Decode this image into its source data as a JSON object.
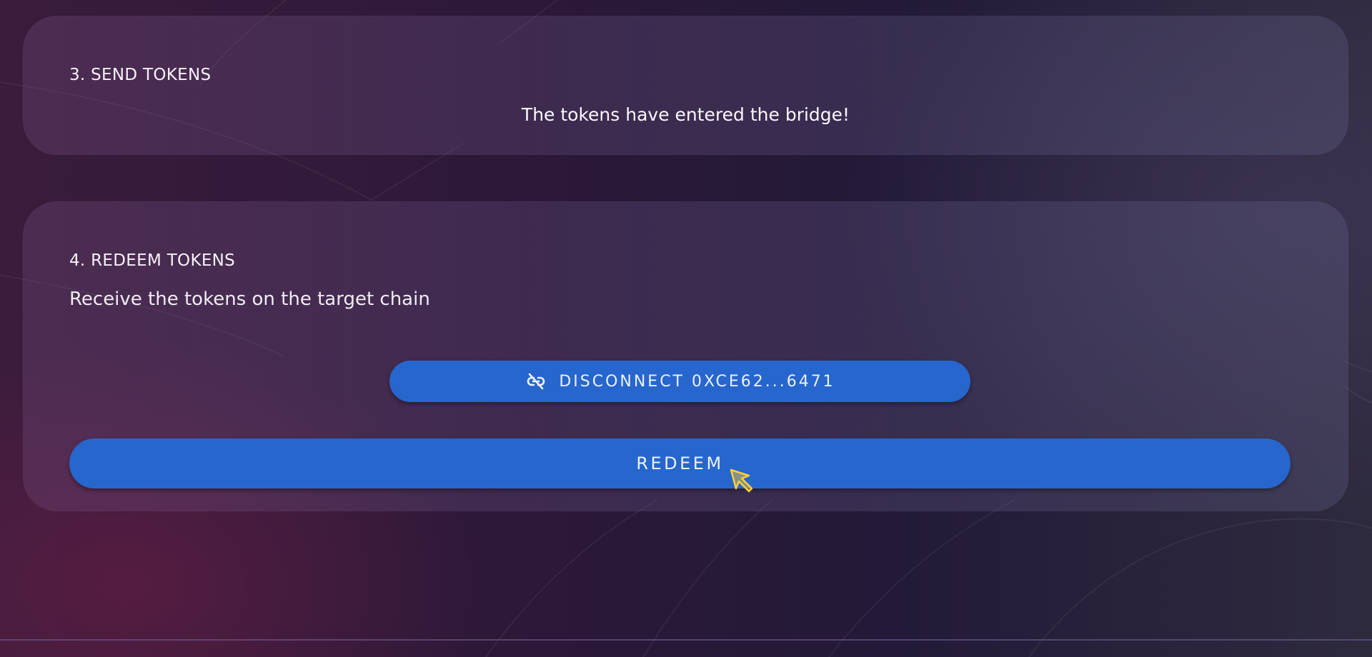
{
  "send_step": {
    "title": "3. SEND TOKENS",
    "status": "The tokens have entered the bridge!"
  },
  "redeem_step": {
    "title": "4. REDEEM TOKENS",
    "description": "Receive the tokens on the target chain",
    "disconnect_label": "DISCONNECT 0XCE62...6471",
    "disconnect_icon": "link-off-icon",
    "redeem_label": "REDEEM"
  },
  "colors": {
    "button": "#2766cc",
    "background_left": "#3a1c3c",
    "background_right": "#2e2a3e"
  }
}
